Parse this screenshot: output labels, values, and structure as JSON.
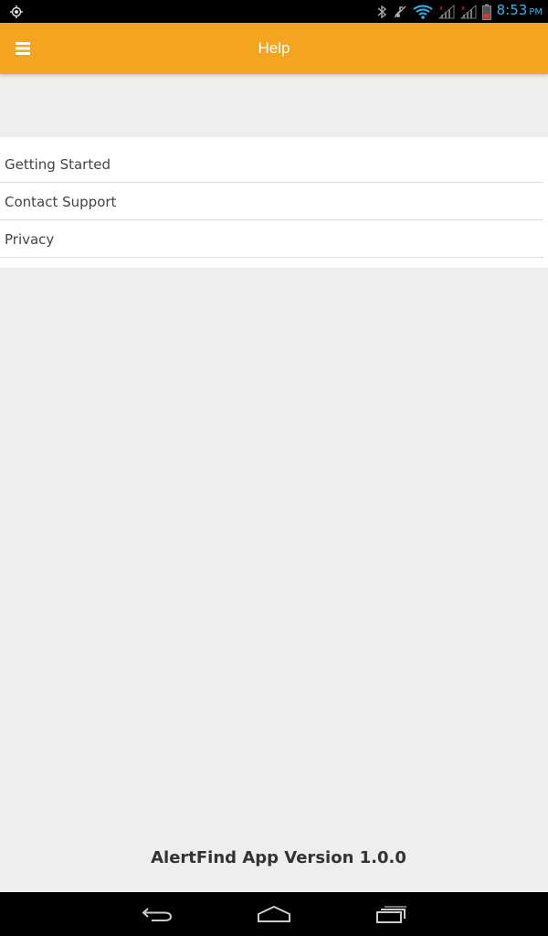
{
  "status_bar": {
    "time": "8:53",
    "ampm": "PM",
    "icons": [
      "location-icon",
      "bluetooth-icon",
      "mute-icon",
      "wifi-icon",
      "signal-icon",
      "signal-icon",
      "battery-icon"
    ],
    "time_color": "#33b5e5"
  },
  "app_bar": {
    "title": "Help",
    "menu_icon": "hamburger-menu-icon",
    "color": "#f4a51f"
  },
  "help_list": {
    "items": [
      {
        "label": "Getting Started"
      },
      {
        "label": "Contact Support"
      },
      {
        "label": "Privacy"
      }
    ]
  },
  "footer": {
    "version_text": "AlertFind App Version 1.0.0"
  },
  "nav_bar": {
    "icons": [
      "back-icon",
      "home-icon",
      "recents-icon"
    ]
  }
}
